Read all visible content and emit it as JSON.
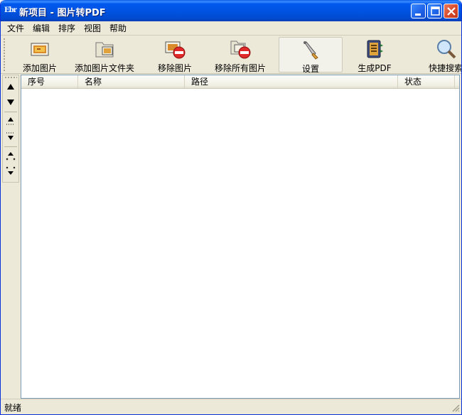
{
  "window": {
    "title": "新项目 - 图片转PDF",
    "app_icon": "pdf-app-icon",
    "app_icon_text": "Ebr"
  },
  "menu": [
    "文件",
    "编辑",
    "排序",
    "视图",
    "帮助"
  ],
  "toolbar": {
    "items": [
      {
        "label": "添加图片",
        "icon": "add-image-icon"
      },
      {
        "label": "添加图片文件夹",
        "icon": "add-folder-icon"
      },
      {
        "label": "移除图片",
        "icon": "remove-image-icon"
      },
      {
        "label": "移除所有图片",
        "icon": "remove-all-icon"
      },
      {
        "label": "设置",
        "icon": "settings-icon",
        "active": true
      },
      {
        "label": "生成PDF",
        "icon": "generate-pdf-icon"
      },
      {
        "label": "快捷搜索",
        "icon": "search-icon"
      }
    ]
  },
  "side_toolbar": {
    "buttons": [
      "move-up-icon",
      "move-down-icon",
      "move-top-icon",
      "move-bottom-icon",
      "expand-icon",
      "collapse-icon"
    ]
  },
  "list": {
    "columns": [
      "序号",
      "名称",
      "路径",
      "状态"
    ],
    "rows": []
  },
  "status": {
    "text": "就绪"
  },
  "colors": {
    "titlebar": "#0054e3",
    "window_bg": "#ece9d8",
    "close_button": "#d94a2b"
  }
}
